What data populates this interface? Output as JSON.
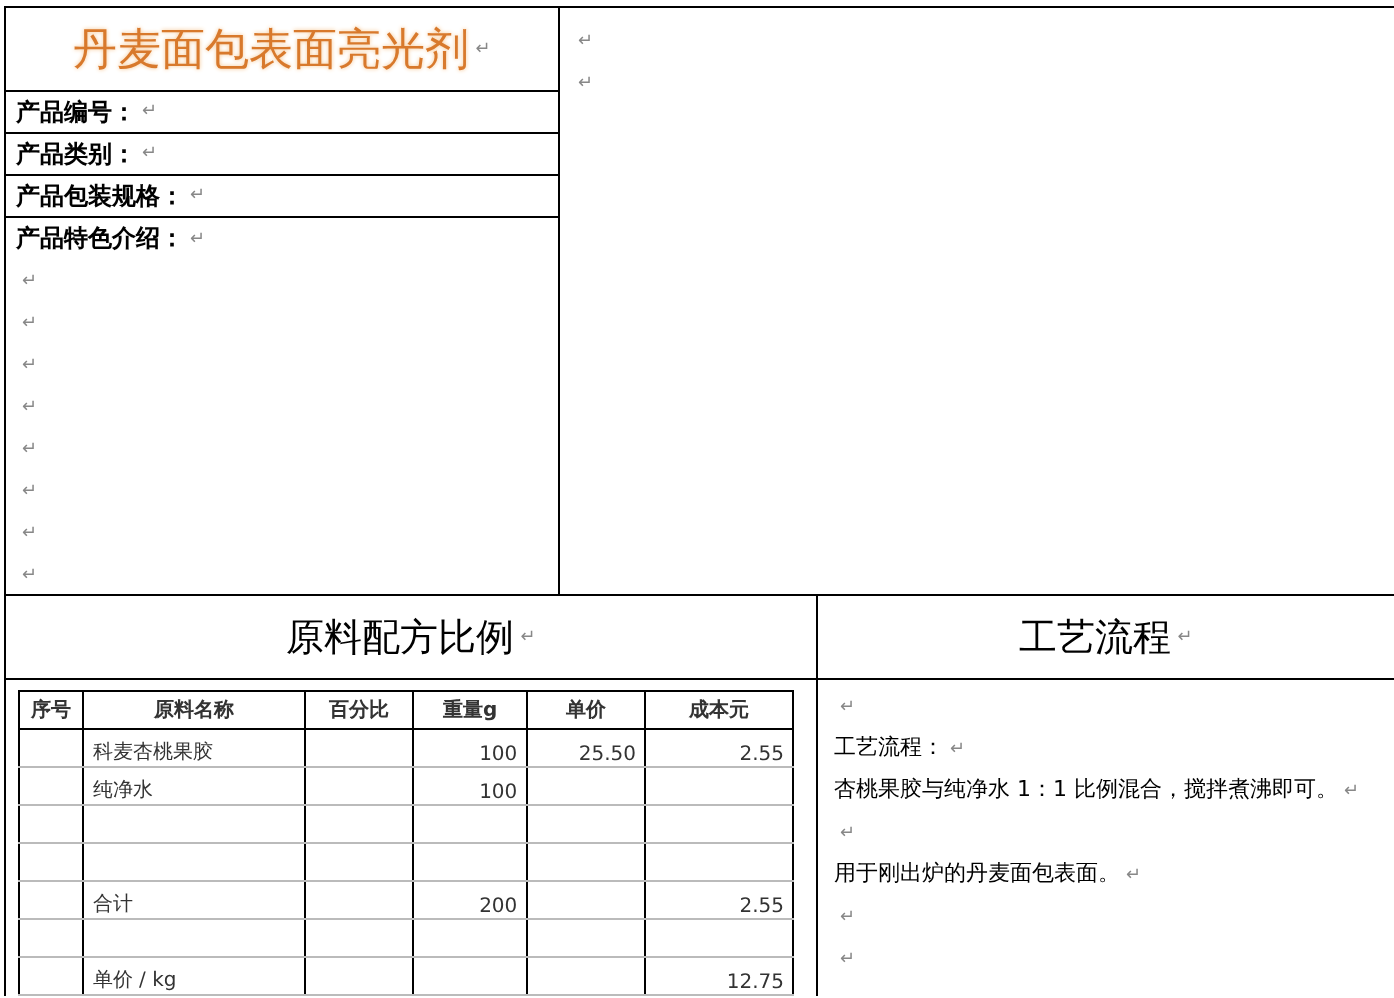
{
  "product_card": {
    "title": {
      "text": "丹麦面包表面亮光剂",
      "mark": "↵"
    },
    "fields": [
      {
        "text": "产品编号：",
        "mark": "↵"
      },
      {
        "text": "产品类别：",
        "mark": "↵"
      },
      {
        "text": "产品包装规格：",
        "mark": "↵"
      }
    ],
    "features": {
      "text": "产品特色介绍：",
      "mark": "↵",
      "empty_lines": [
        "↵",
        "↵",
        "↵",
        "↵",
        "↵",
        "↵",
        "↵",
        "↵"
      ]
    },
    "side_lines": [
      "↵",
      "↵"
    ]
  },
  "recipe": {
    "heading": {
      "text": "原料配方比例",
      "mark": "↵"
    },
    "table": {
      "columns": [
        "序号",
        "原料名称",
        "百分比",
        "重量g",
        "单价",
        "成本元"
      ],
      "rows": [
        [
          "",
          "科麦杏桃果胶",
          "",
          "100",
          "25.50",
          "2.55"
        ],
        [
          "",
          "纯净水",
          "",
          "100",
          "",
          ""
        ],
        [
          "",
          "",
          "",
          "",
          "",
          ""
        ],
        [
          "",
          "",
          "",
          "",
          "",
          ""
        ],
        [
          "",
          "合计",
          "",
          "200",
          "",
          "2.55"
        ],
        [
          "",
          "",
          "",
          "",
          "",
          ""
        ],
        [
          "",
          "单价 / kg",
          "",
          "",
          "",
          "12.75"
        ]
      ]
    }
  },
  "process": {
    "heading": {
      "text": "工艺流程",
      "mark": "↵"
    },
    "paragraphs": [
      {
        "mark": "↵"
      },
      {
        "text": "工艺流程：",
        "mark": "↵"
      },
      {
        "text": "杏桃果胶与纯净水 1：1 比例混合，搅拌煮沸即可。",
        "mark": "↵"
      },
      {
        "mark": "↵"
      },
      {
        "text": "用于刚出炉的丹麦面包表面。",
        "mark": "↵"
      },
      {
        "mark": "↵"
      },
      {
        "mark": "↵"
      }
    ]
  }
}
